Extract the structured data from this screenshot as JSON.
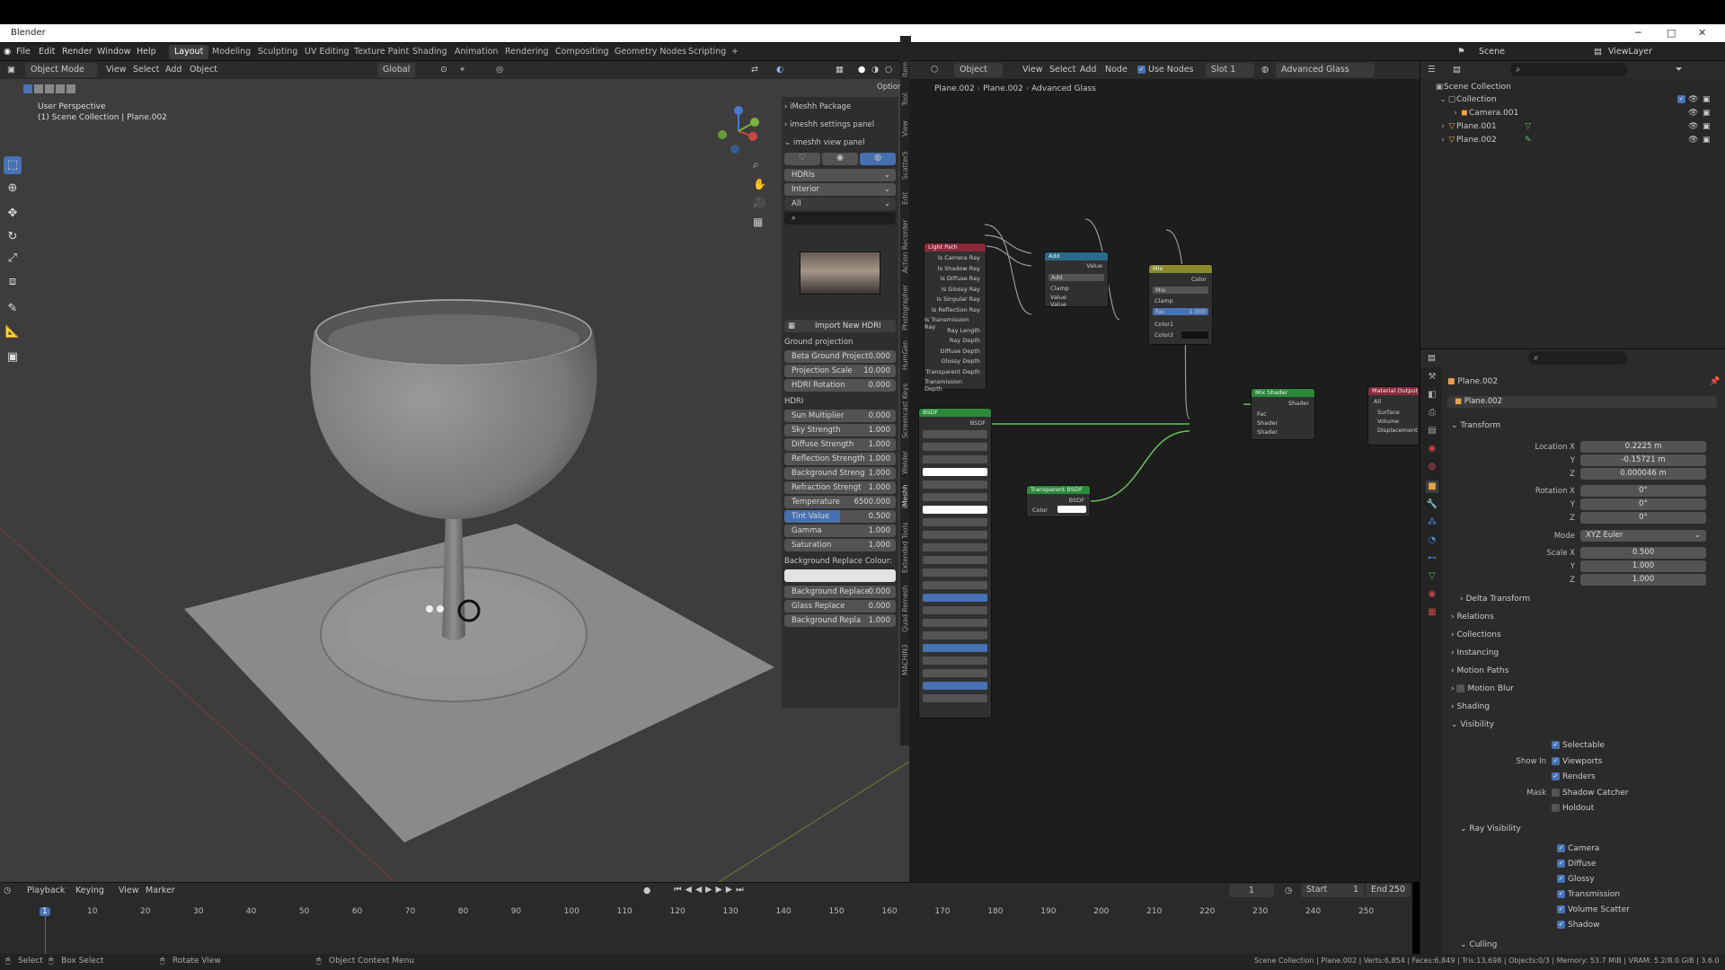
{
  "window": {
    "title": "Blender",
    "min": "─",
    "max": "□",
    "close": "✕"
  },
  "menus": [
    "File",
    "Edit",
    "Render",
    "Window",
    "Help"
  ],
  "workspaces": [
    "Layout",
    "Modeling",
    "Sculpting",
    "UV Editing",
    "Texture Paint",
    "Shading",
    "Animation",
    "Rendering",
    "Compositing",
    "Geometry Nodes",
    "Scripting",
    "+"
  ],
  "scene": {
    "label": "Scene",
    "viewlayer": "ViewLayer"
  },
  "viewport": {
    "mode": "Object Mode",
    "menus": [
      "View",
      "Select",
      "Add",
      "Object"
    ],
    "orientation": "Global",
    "options": "Options",
    "info_line1": "User Perspective",
    "info_line2": "(1) Scene Collection | Plane.002"
  },
  "npanel": {
    "sections": [
      "iMeshh Package",
      "imeshh settings panel",
      "imeshh view panel"
    ],
    "dropdown1": "HDRIs",
    "dropdown2": "Interior",
    "dropdown3": "All",
    "import_btn": "Import New HDRI",
    "ground_header": "Ground projection",
    "ground": [
      {
        "label": "Beta Ground Project",
        "value": "0.000"
      },
      {
        "label": "Projection Scale",
        "value": "10.000"
      },
      {
        "label": "HDRI Rotation",
        "value": "0.000"
      }
    ],
    "hdri_header": "HDRI",
    "hdri": [
      {
        "label": "Sun Multiplier",
        "value": "0.000"
      },
      {
        "label": "Sky Strength",
        "value": "1.000"
      },
      {
        "label": "Diffuse Strength",
        "value": "1.000"
      },
      {
        "label": "Reflection Strength",
        "value": "1.000"
      },
      {
        "label": "Background Streng",
        "value": "1.000"
      },
      {
        "label": "Refraction Strengt",
        "value": "1.000"
      },
      {
        "label": "Temperature",
        "value": "6500.000"
      },
      {
        "label": "Tint Value",
        "value": "0.500"
      },
      {
        "label": "Gamma",
        "value": "1.000"
      },
      {
        "label": "Saturation",
        "value": "1.000"
      }
    ],
    "bg_replace_header": "Background Replace Colour:",
    "replace": [
      {
        "label": "Background Replace",
        "value": "0.000"
      },
      {
        "label": "Glass Replace",
        "value": "0.000"
      },
      {
        "label": "Background Repla",
        "value": "1.000"
      }
    ]
  },
  "vtabs": [
    "Item",
    "Tool",
    "View",
    "Scatter5",
    "Edit",
    "Action Recorder",
    "Photographer",
    "HumGen",
    "Screencast Keys",
    "Welder",
    "iMeshh",
    "Extended Tools",
    "Quad Remesh",
    "MACHIN3"
  ],
  "node_editor": {
    "object": "Object",
    "menus": [
      "View",
      "Select",
      "Add",
      "Node"
    ],
    "use_nodes": "Use Nodes",
    "slot": "Slot 1",
    "material": "Advanced Glass",
    "breadcrumb": [
      "Plane.002",
      "Plane.002",
      "Advanced Glass"
    ],
    "light_path": {
      "title": "Light Path",
      "outputs": [
        "Is Camera Ray",
        "Is Shadow Ray",
        "Is Diffuse Ray",
        "Is Glossy Ray",
        "Is Singular Ray",
        "Is Reflection Ray",
        "Is Transmission Ray",
        "Ray Length",
        "Ray Depth",
        "Diffuse Depth",
        "Glossy Depth",
        "Transparent Depth",
        "Transmission Depth"
      ]
    },
    "add_node": {
      "title": "Add",
      "out": "Value",
      "op": "Add",
      "clamp": "Clamp",
      "in1": "Value",
      "in2": "Value"
    },
    "mix_node": {
      "title": "Mix",
      "out": "Color",
      "mode": "Mix",
      "clamp": "Clamp",
      "fac": "Fac",
      "fac_val": "1.000",
      "c1": "Color1",
      "c2": "Color2"
    },
    "mix_shader": {
      "title": "Mix Shader",
      "out": "Shader",
      "fac": "Fac",
      "s1": "Shader",
      "s2": "Shader"
    },
    "mat_output": {
      "title": "Material Output",
      "target": "All",
      "in": [
        "Surface",
        "Volume",
        "Displacement"
      ]
    },
    "transparent": {
      "title": "Transparent BSDF",
      "out": "BSDF",
      "color": "Color"
    },
    "bsdf": {
      "title": "BSDF",
      "out": "BSDF"
    }
  },
  "outliner": {
    "root": "Scene Collection",
    "items": [
      "Collection",
      "Camera.001",
      "Plane.001",
      "Plane.002"
    ]
  },
  "props": {
    "object_name": "Plane.002",
    "data_name": "Plane.002",
    "transform": "Transform",
    "location": {
      "label": "Location X",
      "x": "0.2225 m",
      "y": "-0.15721 m",
      "z": "0.000046 m"
    },
    "rotation": {
      "label": "Rotation X",
      "x": "0°",
      "y": "0°",
      "z": "0°"
    },
    "mode_label": "Mode",
    "mode": "XYZ Euler",
    "scale": {
      "label": "Scale X",
      "x": "0.500",
      "y": "1.000",
      "z": "1.000"
    },
    "axis_y": "Y",
    "axis_z": "Z",
    "sections": [
      "Delta Transform",
      "Relations",
      "Collections",
      "Instancing",
      "Motion Paths",
      "Motion Blur",
      "Shading",
      "Visibility"
    ],
    "selectable": "Selectable",
    "show_in": "Show In",
    "viewports": "Viewports",
    "renders": "Renders",
    "mask": "Mask",
    "shadow_catcher": "Shadow Catcher",
    "holdout": "Holdout",
    "ray_visibility": "Ray Visibility",
    "rays": [
      "Camera",
      "Diffuse",
      "Glossy",
      "Transmission",
      "Volume Scatter",
      "Shadow"
    ],
    "culling": "Culling"
  },
  "timeline": {
    "menus": [
      "Playback",
      "Keying",
      "View",
      "Marker"
    ],
    "current": "1",
    "start_label": "Start",
    "start": "1",
    "end_label": "End",
    "end": "250",
    "ticks": [
      "1",
      "10",
      "20",
      "30",
      "40",
      "50",
      "60",
      "70",
      "80",
      "90",
      "100",
      "110",
      "120",
      "130",
      "140",
      "150",
      "160",
      "170",
      "180",
      "190",
      "200",
      "210",
      "220",
      "230",
      "240",
      "250"
    ]
  },
  "status": {
    "select": "Select",
    "box_select": "Box Select",
    "rotate": "Rotate View",
    "context": "Object Context Menu",
    "info": "Scene Collection | Plane.002 | Verts:6,854 | Faces:6,849 | Tris:13,698 | Objects:0/3 | Memory: 53.7 MiB | VRAM: 5.2/8.0 GiB | 3.6.0"
  }
}
